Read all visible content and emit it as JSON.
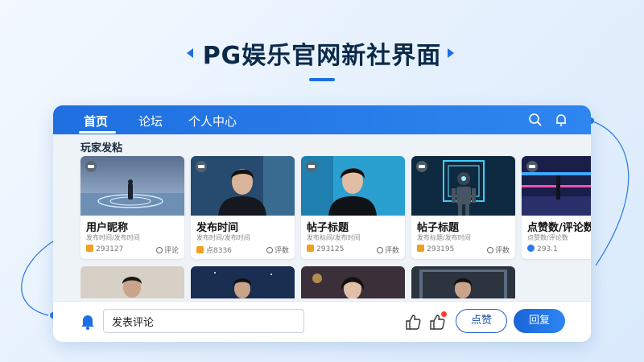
{
  "hero": {
    "title": "PG娱乐官网新社界面"
  },
  "nav": {
    "tabs": [
      "首页",
      "论坛",
      "个人中心"
    ]
  },
  "section": {
    "title": "玩家发粘"
  },
  "cards": [
    {
      "title": "用户昵称",
      "sub": "发布时间/发布时间",
      "stat1": "293127",
      "stat2": "评论"
    },
    {
      "title": "发布时间",
      "sub": "发布时间/发布时间",
      "stat1": "点8336",
      "stat2": "评数"
    },
    {
      "title": "帖子标题",
      "sub": "发布标间/发布时间",
      "stat1": "293125",
      "stat2": "评数"
    },
    {
      "title": "帖子标题",
      "sub": "发布标题/发布时间",
      "stat1": "293195",
      "stat2": "评数"
    },
    {
      "title": "点赞数/评论数",
      "sub": "点赞数/评论数",
      "stat1": "293.1",
      "stat2": ""
    }
  ],
  "bottom": {
    "comment_value": "发表评论",
    "like_label": "点赞",
    "reply_label": "回复"
  },
  "colors": {
    "primary": "#1d6ee6",
    "topbar": "#2f86f0",
    "badge": "#ff3b30"
  }
}
